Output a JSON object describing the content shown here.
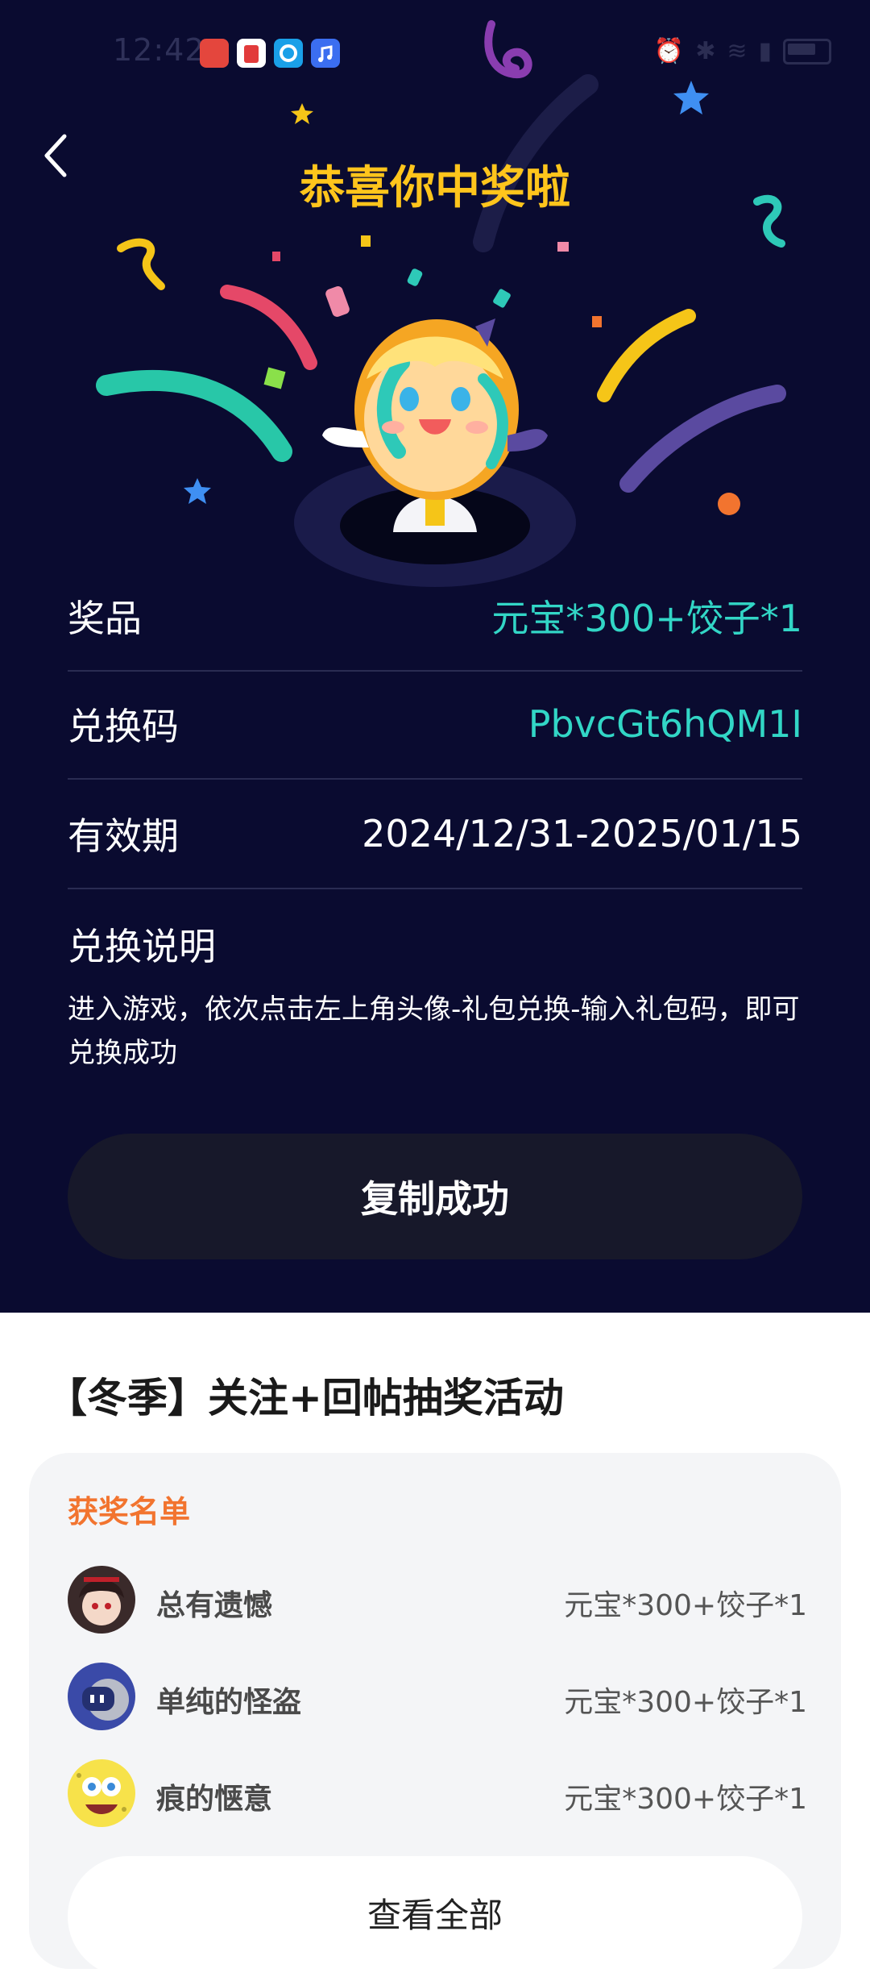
{
  "status_bar": {
    "time": "12:42"
  },
  "header": {
    "title": "恭喜你中奖啦"
  },
  "reward": {
    "prize_label": "奖品",
    "prize_value": "元宝*300+饺子*1",
    "code_label": "兑换码",
    "code_value": "PbvcGt6hQM1I",
    "validity_label": "有效期",
    "validity_value": "2024/12/31-2025/01/15",
    "desc_title": "兑换说明",
    "desc_text": "进入游戏，依次点击左上角头像-礼包兑换-输入礼包码，即可兑换成功",
    "copy_button": "复制成功"
  },
  "activity": {
    "title": "【冬季】关注+回帖抽奖活动",
    "winners_title": "获奖名单",
    "winners": [
      {
        "name": "总有遗憾",
        "prize": "元宝*300+饺子*1"
      },
      {
        "name": "单纯的怪盗",
        "prize": "元宝*300+饺子*1"
      },
      {
        "name": "痕的惬意",
        "prize": "元宝*300+饺子*1"
      }
    ],
    "view_all": "查看全部"
  },
  "colors": {
    "background_dark": "#0a0b30",
    "title_yellow": "#ffc51c",
    "teal_value": "#32d6c6",
    "winners_orange": "#f2742f"
  }
}
